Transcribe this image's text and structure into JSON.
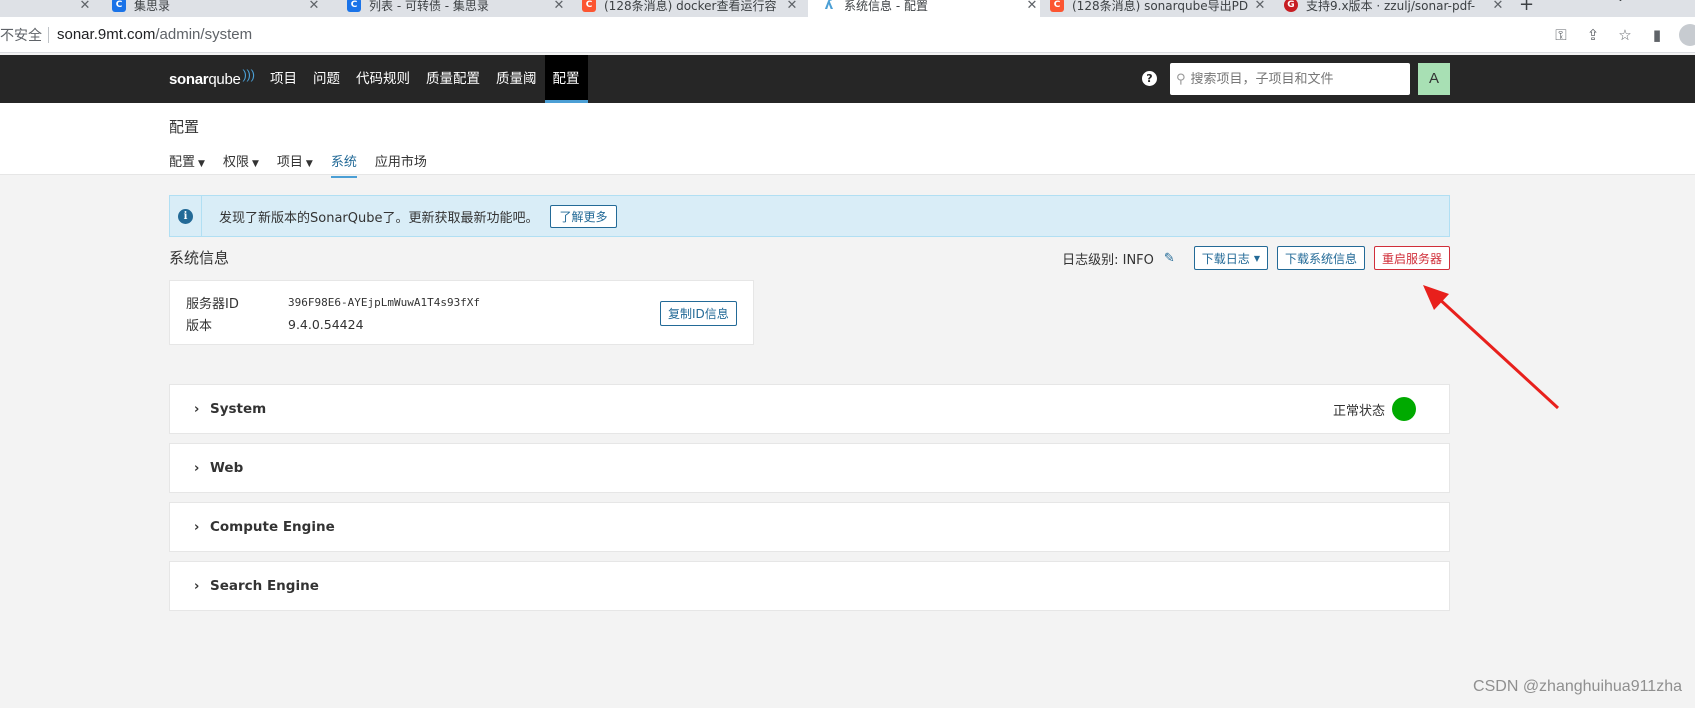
{
  "browser": {
    "tabs": [
      {
        "title": "集思录",
        "icon": "jisilu-favicon",
        "color": "#1a73e8"
      },
      {
        "title": "列表 - 可转债 - 集思录",
        "icon": "jisilu-favicon",
        "color": "#1a73e8"
      },
      {
        "title": "(128条消息) docker查看运行容",
        "icon": "csdn-favicon",
        "color": "#fc5531"
      },
      {
        "title": "系统信息 - 配置",
        "icon": "sonarqube-favicon",
        "color": "#4b9fd5"
      },
      {
        "title": "(128条消息) sonarqube导出PD",
        "icon": "csdn-favicon",
        "color": "#fc5531"
      },
      {
        "title": "支持9.x版本 · zzulj/sonar-pdf-",
        "icon": "gitee-favicon",
        "color": "#c71d23"
      }
    ],
    "insecure_label": "不安全",
    "url_host": "sonar.9mt.com",
    "url_path": "/admin/system"
  },
  "topnav": {
    "logo_bold": "sonar",
    "logo_light": "qube",
    "items": [
      "项目",
      "问题",
      "代码规则",
      "质量配置",
      "质量阈",
      "配置"
    ],
    "active_item": "配置",
    "search_placeholder": "搜索项目，子项目和文件",
    "avatar_letter": "A"
  },
  "page": {
    "title": "配置",
    "subnav": [
      {
        "label": "配置",
        "dropdown": true
      },
      {
        "label": "权限",
        "dropdown": true
      },
      {
        "label": "项目",
        "dropdown": true
      },
      {
        "label": "系统",
        "dropdown": false
      },
      {
        "label": "应用市场",
        "dropdown": false
      }
    ],
    "active_subnav": "系统"
  },
  "alert": {
    "message": "发现了新版本的SonarQube了。更新获取最新功能吧。",
    "button": "了解更多"
  },
  "system_info": {
    "title": "系统信息",
    "log_level_label": "日志级别:",
    "log_level_value": "INFO",
    "download_logs": "下载日志",
    "download_system_info": "下载系统信息",
    "restart_server": "重启服务器",
    "server_id_label": "服务器ID",
    "server_id_value": "396F98E6-AYEjpLmWuwA1T4s93fXf",
    "version_label": "版本",
    "version_value": "9.4.0.54424",
    "copy_button": "复制ID信息"
  },
  "panels": [
    {
      "title": "System",
      "status": "正常状态",
      "status_color": "#00aa00"
    },
    {
      "title": "Web"
    },
    {
      "title": "Compute Engine"
    },
    {
      "title": "Search Engine"
    }
  ],
  "watermark": "CSDN @zhanghuihua911zha",
  "colors": {
    "nav_bg": "#262626",
    "accent": "#236a97",
    "danger": "#d02f3a",
    "ok": "#00aa00",
    "annotation_arrow": "#e8201c"
  }
}
